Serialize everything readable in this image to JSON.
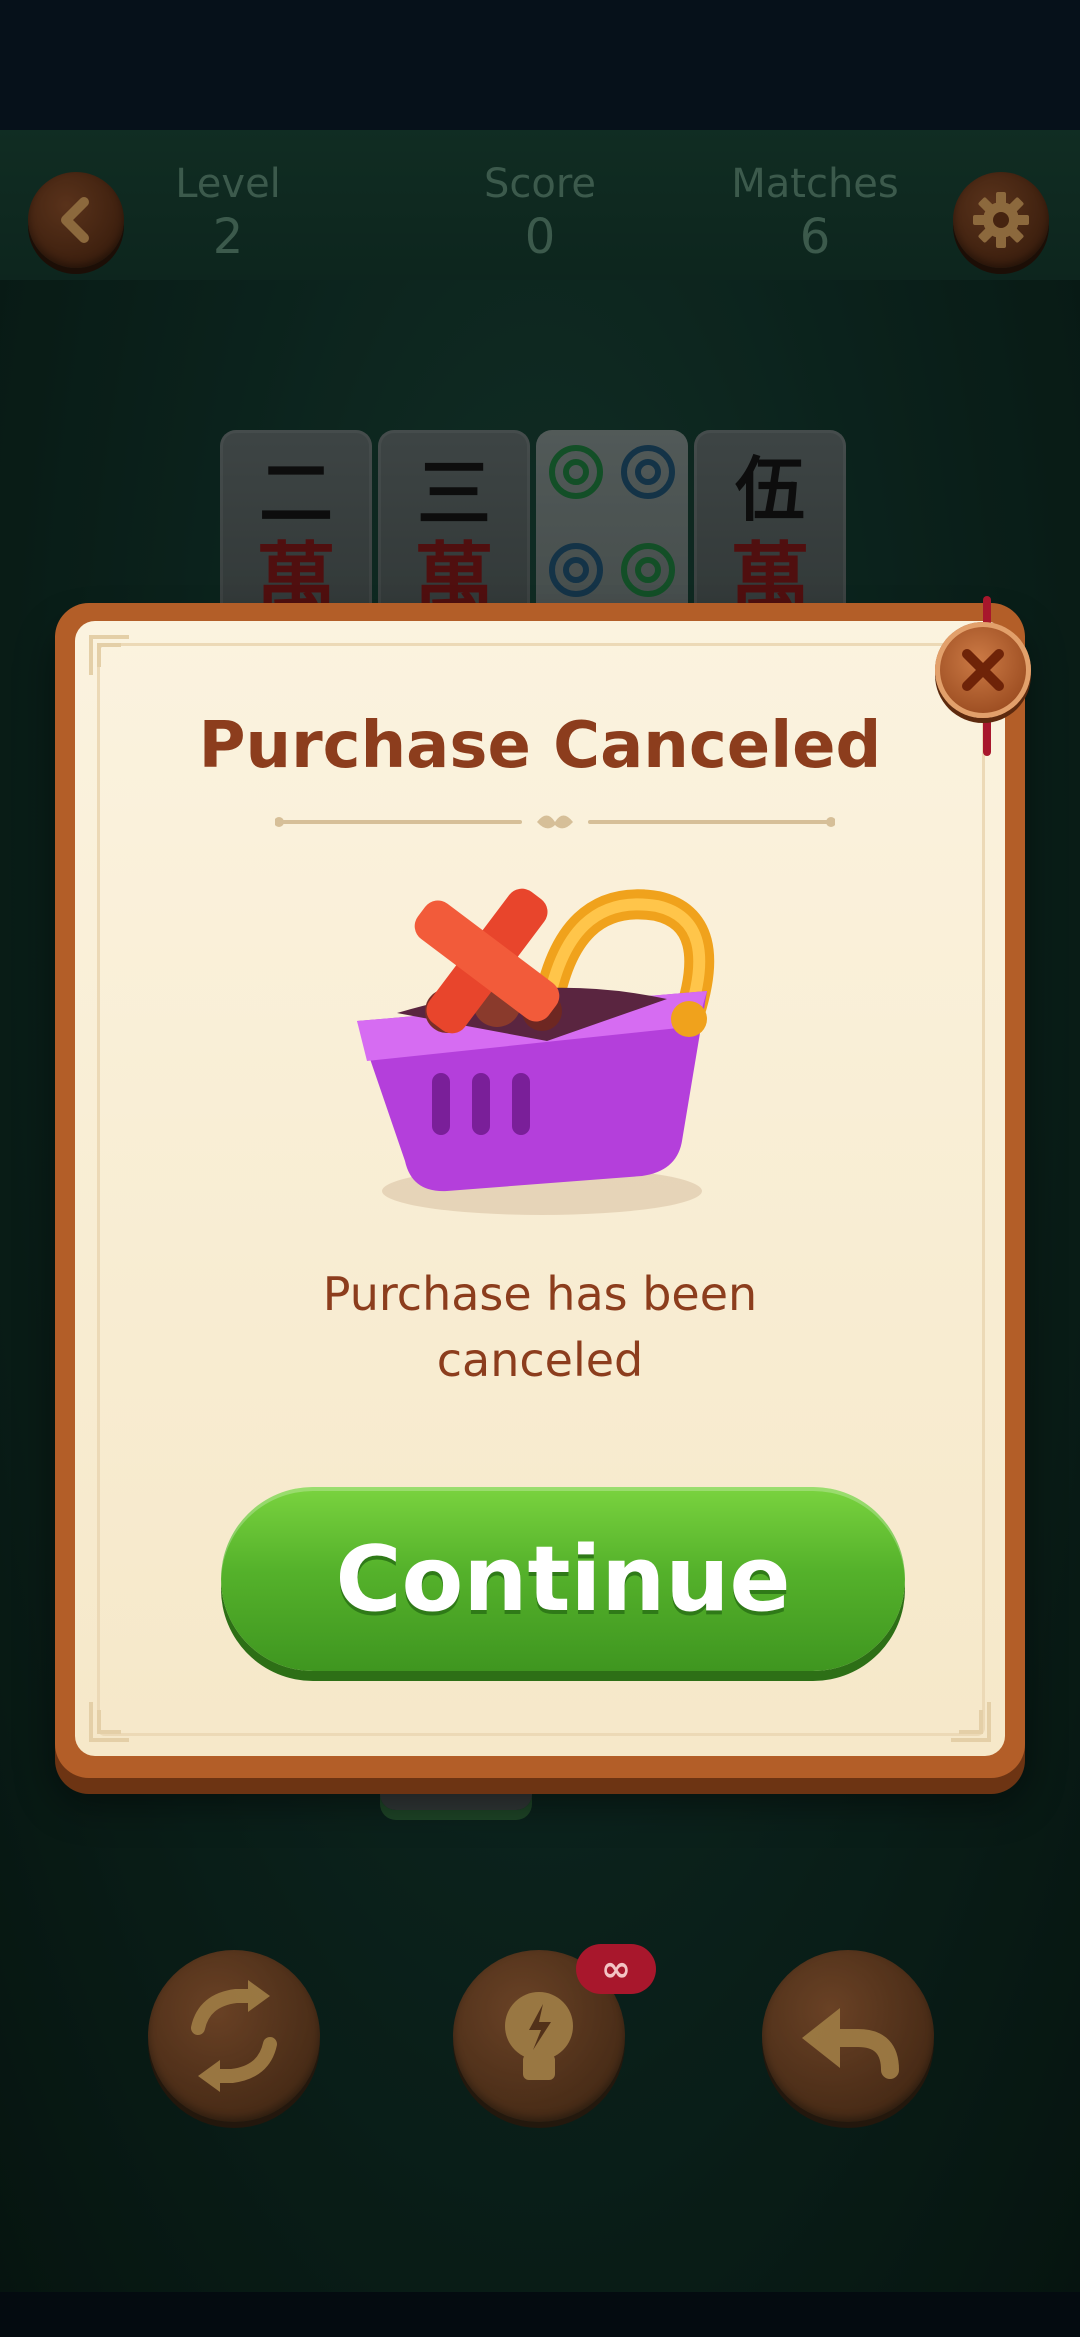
{
  "header": {
    "stats": [
      {
        "label": "Level",
        "value": "2"
      },
      {
        "label": "Score",
        "value": "0"
      },
      {
        "label": "Matches",
        "value": "6"
      }
    ]
  },
  "board": {
    "tiles": [
      {
        "top": "二",
        "bottom": "萬"
      },
      {
        "top": "三",
        "bottom": "萬"
      },
      {
        "suit": "circles",
        "count": 4
      },
      {
        "top": "伍",
        "bottom": "萬"
      }
    ]
  },
  "modal": {
    "title": "Purchase Canceled",
    "message": "Purchase has been canceled",
    "continue_label": "Continue"
  },
  "toolbar": {
    "hint_badge": "∞"
  },
  "icons": [
    "back-icon",
    "gear-icon",
    "close-icon",
    "basket-icon",
    "shuffle-icon",
    "hint-bulb-icon",
    "undo-icon"
  ],
  "colors": {
    "title_text": "#8c3d1d",
    "continue_button": "#55b22b",
    "modal_border": "#b35e28",
    "basket": "#c94fe6",
    "badge": "#a8172c"
  }
}
